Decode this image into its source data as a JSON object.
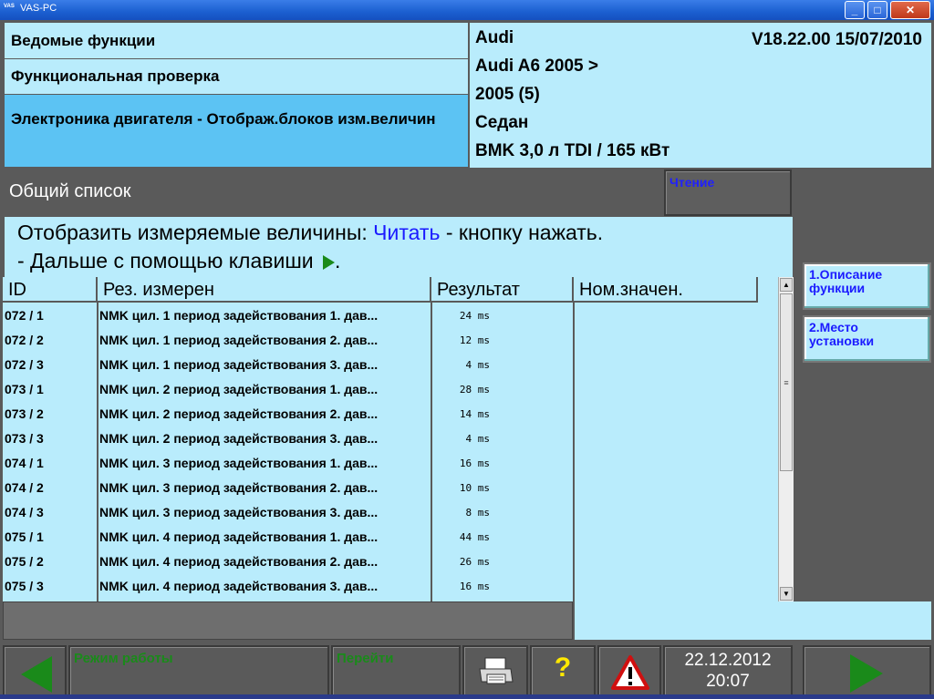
{
  "window": {
    "title": "VAS-PC",
    "icon_text": "VAS"
  },
  "header": {
    "left": [
      "Ведомые функции",
      "Функциональная проверка",
      "Электроника двигателя - Отображ.блоков изм.величин"
    ],
    "right": {
      "make": "Audi",
      "version": "V18.22.00 15/07/2010",
      "model": "Audi A6 2005 >",
      "year": "2005 (5)",
      "body": "Седан",
      "engine": "BMK 3,0 л TDI / 165 кВт"
    }
  },
  "list_title": "Общий список",
  "read_button": "Чтение",
  "instructions": {
    "line1_prefix": "Отобразить измеряемые величины: ",
    "line1_link": "Читать",
    "line1_suffix": "  - кнопку нажать.",
    "line2": "- Дальше с помощью клавиши ",
    "line2_end": "."
  },
  "table": {
    "headers": [
      "ID",
      "Рез. измерен",
      "Результат",
      "Ном.значен."
    ],
    "rows": [
      {
        "id": "072 / 1",
        "name": "NMK цил. 1 период задействования 1. дав...",
        "result": "24 ms",
        "nominal": ""
      },
      {
        "id": "072 / 2",
        "name": "NMK цил. 1 период задействования 2. дав...",
        "result": "12 ms",
        "nominal": ""
      },
      {
        "id": "072 / 3",
        "name": "NMK цил. 1 период задействования 3. дав...",
        "result": "4 ms",
        "nominal": ""
      },
      {
        "id": "073 / 1",
        "name": "NMK цил. 2 период задействования 1. дав...",
        "result": "28 ms",
        "nominal": ""
      },
      {
        "id": "073 / 2",
        "name": "NMK цил. 2 период задействования 2. дав...",
        "result": "14 ms",
        "nominal": ""
      },
      {
        "id": "073 / 3",
        "name": "NMK цил. 2 период задействования 3. дав...",
        "result": "4 ms",
        "nominal": ""
      },
      {
        "id": "074 / 1",
        "name": "NMK цил. 3 период задействования 1. дав...",
        "result": "16 ms",
        "nominal": ""
      },
      {
        "id": "074 / 2",
        "name": "NMK цил. 3 период задействования 2. дав...",
        "result": "10 ms",
        "nominal": ""
      },
      {
        "id": "074 / 3",
        "name": "NMK цил. 3 период задействования 3. дав...",
        "result": "8 ms",
        "nominal": ""
      },
      {
        "id": "075 / 1",
        "name": "NMK цил. 4 период задействования 1. дав...",
        "result": "44 ms",
        "nominal": ""
      },
      {
        "id": "075 / 2",
        "name": "NMK цил. 4 период задействования 2. дав...",
        "result": "26 ms",
        "nominal": ""
      },
      {
        "id": "075 / 3",
        "name": "NMK цил. 4 период задействования 3. дав...",
        "result": "16 ms",
        "nominal": ""
      }
    ]
  },
  "side_buttons": [
    {
      "label": "1.Описание функции"
    },
    {
      "label": "2.Место установки"
    }
  ],
  "toolbar": {
    "mode_label": "Режим работы",
    "goto_label": "Перейти",
    "help_symbol": "?",
    "date": "22.12.2012",
    "time": "20:07"
  },
  "colors": {
    "panel_bg": "#b9ecfc",
    "active_bg": "#5cc3f3",
    "link_blue": "#1a1aff",
    "arrow_green": "#1a8a1a",
    "help_yellow": "#ffe800"
  },
  "icons": [
    "app-logo-icon",
    "minimize-icon",
    "maximize-icon",
    "close-icon",
    "play-icon",
    "back-arrow-icon",
    "printer-icon",
    "help-icon",
    "warning-icon",
    "forward-arrow-icon"
  ]
}
